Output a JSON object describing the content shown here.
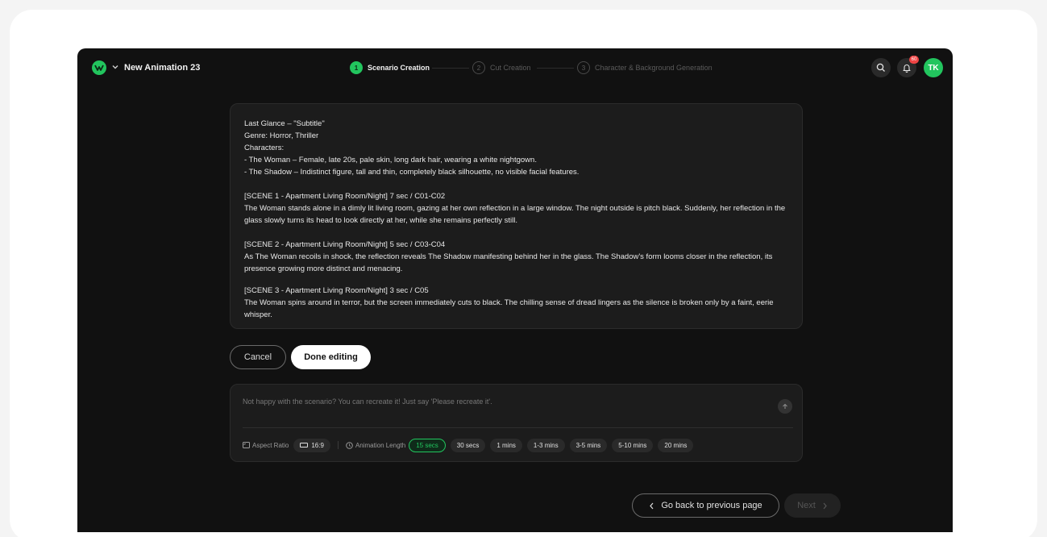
{
  "header": {
    "project_title": "New Animation 23",
    "notification_count": "60",
    "avatar_initials": "TK",
    "steps": [
      {
        "num": "1",
        "label": "Scenario Creation",
        "active": true
      },
      {
        "num": "2",
        "label": "Cut Creation",
        "active": false
      },
      {
        "num": "3",
        "label": "Character & Background Generation",
        "active": false
      }
    ]
  },
  "scenario": {
    "title": "Last Glance – \"Subtitle\"",
    "genre": "Genre: Horror, Thriller",
    "characters_heading": "Characters:",
    "character_1": "- The Woman – Female, late 20s, pale skin, long dark hair, wearing a white nightgown.",
    "character_2": "- The Shadow – Indistinct figure, tall and thin, completely black silhouette, no visible facial features.",
    "scene_1_heading": "[SCENE 1 - Apartment Living Room/Night] 7 sec / C01-C02",
    "scene_1_text": "The Woman stands alone in a dimly lit living room, gazing at her own reflection in a large window. The night outside is pitch black. Suddenly, her reflection in the glass slowly turns its head to look directly at her, while she remains perfectly still.",
    "scene_2_heading": "[SCENE 2 - Apartment Living Room/Night] 5 sec / C03-C04",
    "scene_2_text": "As The Woman recoils in shock, the reflection reveals The Shadow manifesting behind her in the glass. The Shadow's form looms closer in the reflection, its presence growing more distinct and menacing.",
    "scene_3_heading": "[SCENE 3 - Apartment Living Room/Night] 3 sec / C05",
    "scene_3_text": "The Woman spins around in terror, but the screen immediately cuts to black. The chilling sense of dread lingers as the silence is broken only by a faint, eerie whisper."
  },
  "actions": {
    "cancel_label": "Cancel",
    "done_label": "Done editing"
  },
  "prompt": {
    "placeholder": "Not happy with the scenario? You can recreate it! Just say 'Please recreate it'.",
    "aspect_ratio_label": "Aspect Ratio",
    "aspect_ratio_value": "16:9",
    "length_label": "Animation Length",
    "length_options": [
      "15 secs",
      "30 secs",
      "1 mins",
      "1-3 mins",
      "3-5 mins",
      "5-10 mins",
      "20 mins"
    ],
    "length_selected": "15 secs"
  },
  "footer": {
    "back_label": "Go back to previous page",
    "next_label": "Next"
  },
  "colors": {
    "accent": "#22c55e",
    "background": "#111111",
    "panel": "#1c1c1c",
    "badge": "#ef4444"
  }
}
